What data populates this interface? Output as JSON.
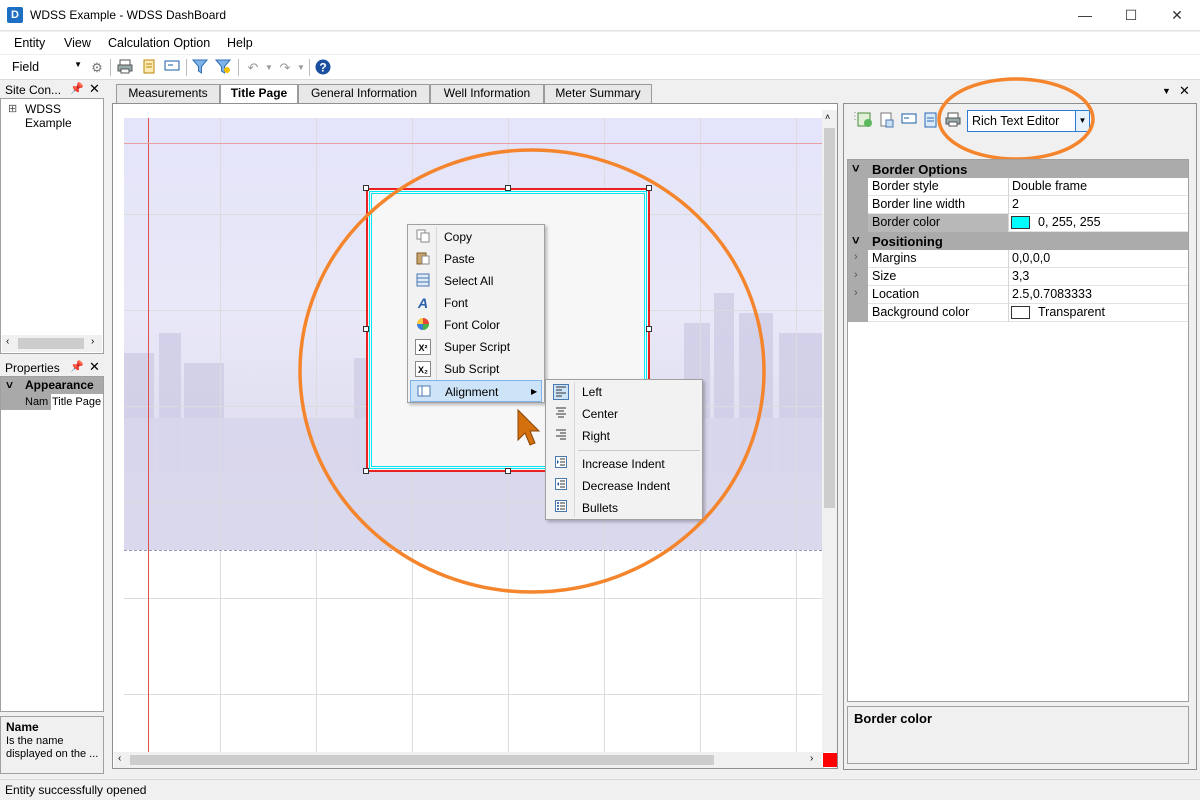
{
  "window": {
    "title": "WDSS Example - WDSS DashBoard",
    "icon_letter": "D",
    "minimize": "—",
    "maximize": "☐",
    "close": "✕"
  },
  "menu": [
    "Entity",
    "View",
    "Calculation Option",
    "Help"
  ],
  "toolbar": {
    "field_select": "Field"
  },
  "site_panel": {
    "title": "Site Con...",
    "tree_item": "WDSS Example",
    "expander": "⊞"
  },
  "properties_panel": {
    "title": "Properties",
    "category": "Appearance",
    "row_name": "Nam",
    "row_value": "Title Page"
  },
  "help_panel": {
    "title": "Name",
    "description": "Is the name displayed on the ..."
  },
  "tabs": [
    "Measurements",
    "Title Page",
    "General Information",
    "Well Information",
    "Meter Summary"
  ],
  "context_menu": [
    "Copy",
    "Paste",
    "Select All",
    "Font",
    "Font Color",
    "Super Script",
    "Sub Script",
    "Alignment"
  ],
  "submenu": [
    "Left",
    "Center",
    "Right",
    "Increase Indent",
    "Decrease Indent",
    "Bullets"
  ],
  "editor_select": "Rich Text Editor",
  "property_grid": {
    "categories": [
      "Border Options",
      "Positioning"
    ],
    "border_rows": [
      {
        "name": "Border style",
        "value": "Double frame"
      },
      {
        "name": "Border line width",
        "value": "2"
      },
      {
        "name": "Border color",
        "value": "0, 255, 255"
      }
    ],
    "positioning_rows": [
      {
        "name": "Margins",
        "value": "0,0,0,0"
      },
      {
        "name": "Size",
        "value": "3,3"
      },
      {
        "name": "Location",
        "value": "2.5,0.7083333"
      },
      {
        "name": "Background color",
        "value": "Transparent"
      }
    ],
    "description_title": "Border color"
  },
  "colors": {
    "accent_orange": "#f5852c",
    "border_color": "#00ffff",
    "selection_red": "#e82121"
  },
  "status": "Entity successfully opened"
}
